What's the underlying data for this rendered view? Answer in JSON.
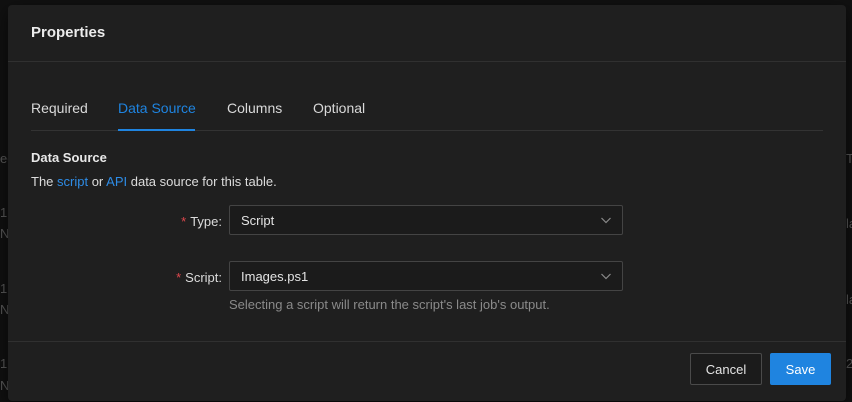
{
  "modal": {
    "title": "Properties"
  },
  "tabs": [
    {
      "label": "Required",
      "active": false
    },
    {
      "label": "Data Source",
      "active": true
    },
    {
      "label": "Columns",
      "active": false
    },
    {
      "label": "Optional",
      "active": false
    }
  ],
  "section": {
    "title": "Data Source",
    "desc_prefix": "The ",
    "link_script": "script",
    "desc_mid": " or ",
    "link_api": "API",
    "desc_suffix": " data source for this table."
  },
  "form": {
    "type": {
      "required_mark": "*",
      "label": "Type:",
      "value": "Script"
    },
    "script": {
      "required_mark": "*",
      "label": "Script:",
      "value": "Images.ps1",
      "help": "Selecting a script will return the script's last job's output."
    }
  },
  "footer": {
    "cancel_label": "Cancel",
    "save_label": "Save"
  },
  "background": {
    "fragments": [
      "ec",
      "1",
      "N",
      "1",
      "N",
      "1",
      "N",
      "Ta",
      "la",
      "la",
      "2"
    ]
  },
  "colors": {
    "accent": "#1f84e0",
    "required": "#e0484e",
    "modal_bg": "#1f1f1f"
  }
}
